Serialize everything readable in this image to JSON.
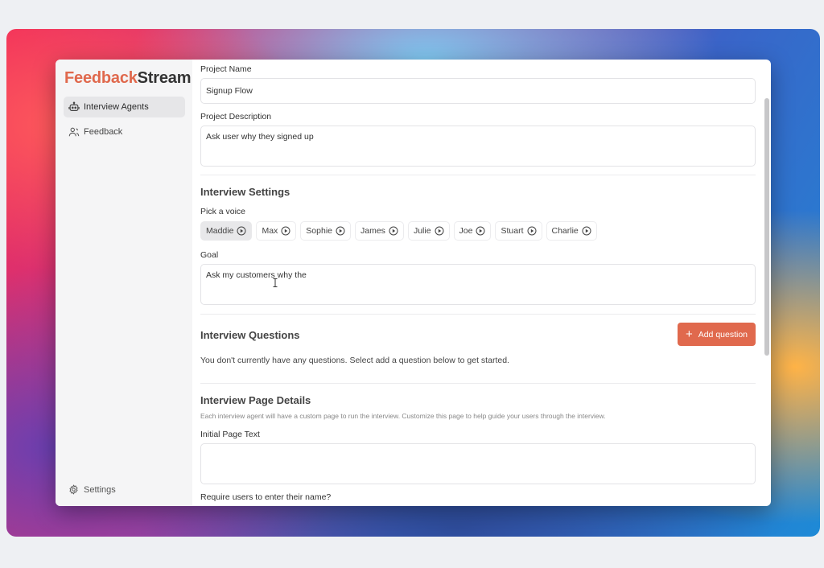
{
  "brand": {
    "part1": "Feedback",
    "part2": "Stream",
    "accent": "#e0694d"
  },
  "sidebar": {
    "items": [
      {
        "label": "Interview Agents",
        "icon": "robot-icon",
        "active": true
      },
      {
        "label": "Feedback",
        "icon": "people-icon",
        "active": false
      }
    ],
    "settings_label": "Settings"
  },
  "form": {
    "project_name_label": "Project Name",
    "project_name_value": "Signup Flow",
    "project_description_label": "Project Description",
    "project_description_value": "Ask user why they signed up",
    "interview_settings_title": "Interview Settings",
    "pick_voice_label": "Pick a voice",
    "voices": [
      "Maddie",
      "Max",
      "Sophie",
      "James",
      "Julie",
      "Joe",
      "Stuart",
      "Charlie"
    ],
    "selected_voice": "Maddie",
    "goal_label": "Goal",
    "goal_value": "Ask my customers why the",
    "interview_questions_title": "Interview Questions",
    "add_question_label": "Add question",
    "no_questions_text": "You don't currently have any questions. Select add a question below to get started.",
    "page_details_title": "Interview Page Details",
    "page_details_help": "Each interview agent will have a custom page to run the interview. Customize this page to help guide your users through the interview.",
    "initial_page_text_label": "Initial Page Text",
    "initial_page_text_value": "",
    "require_name_label": "Require users to enter their name?"
  }
}
